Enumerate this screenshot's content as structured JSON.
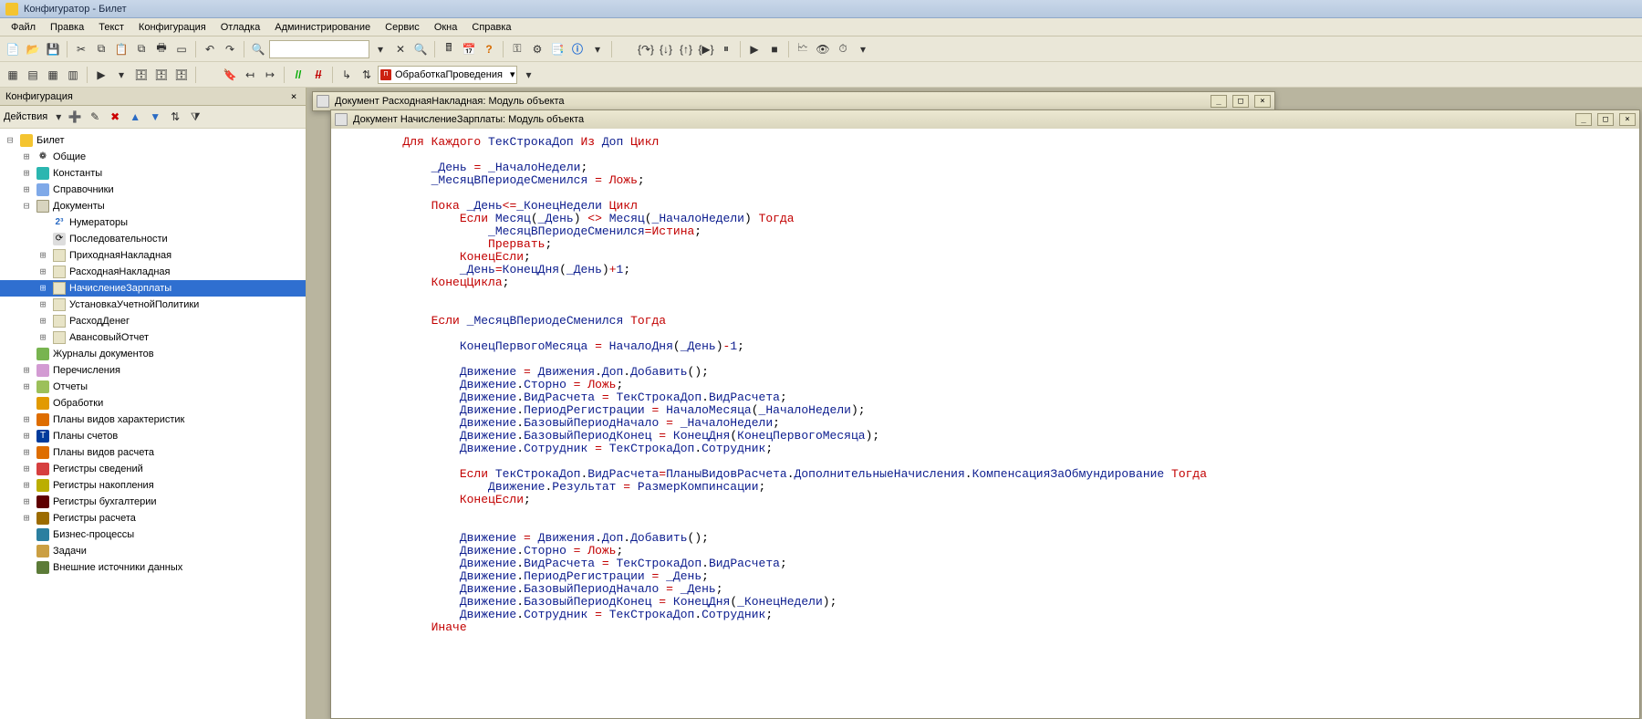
{
  "title": "Конфигуратор - Билет",
  "menu": [
    "Файл",
    "Правка",
    "Текст",
    "Конфигурация",
    "Отладка",
    "Администрирование",
    "Сервис",
    "Окна",
    "Справка"
  ],
  "proc_combo": "ОбработкаПроведения",
  "left_panel": {
    "title": "Конфигурация",
    "actions_label": "Действия"
  },
  "tree": {
    "root": "Билет",
    "common": "Общие",
    "constants": "Константы",
    "catalogs": "Справочники",
    "documents": "Документы",
    "numerators": "Нумераторы",
    "sequences": "Последовательности",
    "docs": [
      "ПриходнаяНакладная",
      "РасходнаяНакладная",
      "НачислениеЗарплаты",
      "УстановкаУчетнойПолитики",
      "РасходДенег",
      "АвансовыйОтчет"
    ],
    "journals": "Журналы документов",
    "enums": "Перечисления",
    "reports": "Отчеты",
    "processings": "Обработки",
    "charplans": "Планы видов характеристик",
    "accplans": "Планы счетов",
    "calcplans": "Планы видов расчета",
    "reginfo": "Регистры сведений",
    "regacc": "Регистры накопления",
    "regbuh": "Регистры бухгалтерии",
    "regcalc": "Регистры расчета",
    "bp": "Бизнес-процессы",
    "tasks": "Задачи",
    "external": "Внешние источники данных"
  },
  "tabs": {
    "back": "Документ РасходнаяНакладная: Модуль объекта",
    "front": "Документ НачислениеЗарплаты: Модуль объекта"
  },
  "code_lines": [
    {
      "indent": 2,
      "tokens": [
        {
          "t": "Для Каждого",
          "c": "kw"
        },
        {
          "t": " ТекСтрокаДоп ",
          "c": "id"
        },
        {
          "t": "Из",
          "c": "kw"
        },
        {
          "t": " Доп ",
          "c": "id"
        },
        {
          "t": "Цикл",
          "c": "kw"
        }
      ]
    },
    {
      "indent": 0,
      "text": ""
    },
    {
      "indent": 3,
      "tokens": [
        {
          "t": "_День ",
          "c": "id"
        },
        {
          "t": "= ",
          "c": "op"
        },
        {
          "t": "_НачалоНедели",
          "c": "id"
        },
        {
          "t": ";",
          "c": ""
        }
      ]
    },
    {
      "indent": 3,
      "tokens": [
        {
          "t": "_МесяцВПериодеСменился ",
          "c": "id"
        },
        {
          "t": "= ",
          "c": "op"
        },
        {
          "t": "Ложь",
          "c": "kw"
        },
        {
          "t": ";",
          "c": ""
        }
      ]
    },
    {
      "indent": 0,
      "text": ""
    },
    {
      "indent": 3,
      "tokens": [
        {
          "t": "Пока ",
          "c": "kw"
        },
        {
          "t": "_День",
          "c": "id"
        },
        {
          "t": "<=",
          "c": "op"
        },
        {
          "t": "_КонецНедели ",
          "c": "id"
        },
        {
          "t": "Цикл",
          "c": "kw"
        }
      ]
    },
    {
      "indent": 4,
      "tokens": [
        {
          "t": "Если ",
          "c": "kw"
        },
        {
          "t": "Месяц",
          "c": "id"
        },
        {
          "t": "(",
          "c": ""
        },
        {
          "t": "_День",
          "c": "id"
        },
        {
          "t": ") ",
          "c": ""
        },
        {
          "t": "<> ",
          "c": "op"
        },
        {
          "t": "Месяц",
          "c": "id"
        },
        {
          "t": "(",
          "c": ""
        },
        {
          "t": "_НачалоНедели",
          "c": "id"
        },
        {
          "t": ") ",
          "c": ""
        },
        {
          "t": "Тогда",
          "c": "kw"
        }
      ]
    },
    {
      "indent": 5,
      "tokens": [
        {
          "t": "_МесяцВПериодеСменился",
          "c": "id"
        },
        {
          "t": "=",
          "c": "op"
        },
        {
          "t": "Истина",
          "c": "kw"
        },
        {
          "t": ";",
          "c": ""
        }
      ]
    },
    {
      "indent": 5,
      "tokens": [
        {
          "t": "Прервать",
          "c": "kw"
        },
        {
          "t": ";",
          "c": ""
        }
      ]
    },
    {
      "indent": 4,
      "tokens": [
        {
          "t": "КонецЕсли",
          "c": "kw"
        },
        {
          "t": ";",
          "c": ""
        }
      ]
    },
    {
      "indent": 4,
      "tokens": [
        {
          "t": "_День",
          "c": "id"
        },
        {
          "t": "=",
          "c": "op"
        },
        {
          "t": "КонецДня",
          "c": "id"
        },
        {
          "t": "(",
          "c": ""
        },
        {
          "t": "_День",
          "c": "id"
        },
        {
          "t": ")",
          "c": ""
        },
        {
          "t": "+",
          "c": "op"
        },
        {
          "t": "1",
          "c": "id"
        },
        {
          "t": ";",
          "c": ""
        }
      ]
    },
    {
      "indent": 3,
      "tokens": [
        {
          "t": "КонецЦикла",
          "c": "kw"
        },
        {
          "t": ";",
          "c": ""
        }
      ]
    },
    {
      "indent": 0,
      "text": ""
    },
    {
      "indent": 0,
      "text": ""
    },
    {
      "indent": 3,
      "tokens": [
        {
          "t": "Если ",
          "c": "kw"
        },
        {
          "t": "_МесяцВПериодеСменился ",
          "c": "id"
        },
        {
          "t": "Тогда",
          "c": "kw"
        }
      ]
    },
    {
      "indent": 0,
      "text": ""
    },
    {
      "indent": 4,
      "tokens": [
        {
          "t": "КонецПервогоМесяца ",
          "c": "id"
        },
        {
          "t": "= ",
          "c": "op"
        },
        {
          "t": "НачалоДня",
          "c": "id"
        },
        {
          "t": "(",
          "c": ""
        },
        {
          "t": "_День",
          "c": "id"
        },
        {
          "t": ")",
          "c": ""
        },
        {
          "t": "-",
          "c": "op"
        },
        {
          "t": "1",
          "c": "id"
        },
        {
          "t": ";",
          "c": ""
        }
      ]
    },
    {
      "indent": 0,
      "text": ""
    },
    {
      "indent": 4,
      "tokens": [
        {
          "t": "Движение ",
          "c": "id"
        },
        {
          "t": "= ",
          "c": "op"
        },
        {
          "t": "Движения",
          "c": "id"
        },
        {
          "t": ".",
          "c": ""
        },
        {
          "t": "Доп",
          "c": "id"
        },
        {
          "t": ".",
          "c": ""
        },
        {
          "t": "Добавить",
          "c": "id"
        },
        {
          "t": "();",
          "c": ""
        }
      ]
    },
    {
      "indent": 4,
      "tokens": [
        {
          "t": "Движение",
          "c": "id"
        },
        {
          "t": ".",
          "c": ""
        },
        {
          "t": "Сторно ",
          "c": "id"
        },
        {
          "t": "= ",
          "c": "op"
        },
        {
          "t": "Ложь",
          "c": "kw"
        },
        {
          "t": ";",
          "c": ""
        }
      ]
    },
    {
      "indent": 4,
      "tokens": [
        {
          "t": "Движение",
          "c": "id"
        },
        {
          "t": ".",
          "c": ""
        },
        {
          "t": "ВидРасчета ",
          "c": "id"
        },
        {
          "t": "= ",
          "c": "op"
        },
        {
          "t": "ТекСтрокаДоп",
          "c": "id"
        },
        {
          "t": ".",
          "c": ""
        },
        {
          "t": "ВидРасчета",
          "c": "id"
        },
        {
          "t": ";",
          "c": ""
        }
      ]
    },
    {
      "indent": 4,
      "tokens": [
        {
          "t": "Движение",
          "c": "id"
        },
        {
          "t": ".",
          "c": ""
        },
        {
          "t": "ПериодРегистрации ",
          "c": "id"
        },
        {
          "t": "= ",
          "c": "op"
        },
        {
          "t": "НачалоМесяца",
          "c": "id"
        },
        {
          "t": "(",
          "c": ""
        },
        {
          "t": "_НачалоНедели",
          "c": "id"
        },
        {
          "t": ");",
          "c": ""
        }
      ]
    },
    {
      "indent": 4,
      "tokens": [
        {
          "t": "Движение",
          "c": "id"
        },
        {
          "t": ".",
          "c": ""
        },
        {
          "t": "БазовыйПериодНачало ",
          "c": "id"
        },
        {
          "t": "= ",
          "c": "op"
        },
        {
          "t": "_НачалоНедели",
          "c": "id"
        },
        {
          "t": ";",
          "c": ""
        }
      ]
    },
    {
      "indent": 4,
      "tokens": [
        {
          "t": "Движение",
          "c": "id"
        },
        {
          "t": ".",
          "c": ""
        },
        {
          "t": "БазовыйПериодКонец ",
          "c": "id"
        },
        {
          "t": "= ",
          "c": "op"
        },
        {
          "t": "КонецДня",
          "c": "id"
        },
        {
          "t": "(",
          "c": ""
        },
        {
          "t": "КонецПервогоМесяца",
          "c": "id"
        },
        {
          "t": ");",
          "c": ""
        }
      ]
    },
    {
      "indent": 4,
      "tokens": [
        {
          "t": "Движение",
          "c": "id"
        },
        {
          "t": ".",
          "c": ""
        },
        {
          "t": "Сотрудник ",
          "c": "id"
        },
        {
          "t": "= ",
          "c": "op"
        },
        {
          "t": "ТекСтрокаДоп",
          "c": "id"
        },
        {
          "t": ".",
          "c": ""
        },
        {
          "t": "Сотрудник",
          "c": "id"
        },
        {
          "t": ";",
          "c": ""
        }
      ]
    },
    {
      "indent": 0,
      "text": ""
    },
    {
      "indent": 4,
      "tokens": [
        {
          "t": "Если ",
          "c": "kw"
        },
        {
          "t": "ТекСтрокаДоп",
          "c": "id"
        },
        {
          "t": ".",
          "c": ""
        },
        {
          "t": "ВидРасчета",
          "c": "id"
        },
        {
          "t": "=",
          "c": "op"
        },
        {
          "t": "ПланыВидовРасчета",
          "c": "id"
        },
        {
          "t": ".",
          "c": ""
        },
        {
          "t": "ДополнительныеНачисления",
          "c": "id"
        },
        {
          "t": ".",
          "c": ""
        },
        {
          "t": "КомпенсацияЗаОбмундирование ",
          "c": "id"
        },
        {
          "t": "Тогда",
          "c": "kw"
        }
      ]
    },
    {
      "indent": 5,
      "tokens": [
        {
          "t": "Движение",
          "c": "id"
        },
        {
          "t": ".",
          "c": ""
        },
        {
          "t": "Результат ",
          "c": "id"
        },
        {
          "t": "= ",
          "c": "op"
        },
        {
          "t": "РазмерКомпинсации",
          "c": "id"
        },
        {
          "t": ";",
          "c": ""
        }
      ]
    },
    {
      "indent": 4,
      "tokens": [
        {
          "t": "КонецЕсли",
          "c": "kw"
        },
        {
          "t": ";",
          "c": ""
        }
      ]
    },
    {
      "indent": 0,
      "text": ""
    },
    {
      "indent": 0,
      "text": ""
    },
    {
      "indent": 4,
      "tokens": [
        {
          "t": "Движение ",
          "c": "id"
        },
        {
          "t": "= ",
          "c": "op"
        },
        {
          "t": "Движения",
          "c": "id"
        },
        {
          "t": ".",
          "c": ""
        },
        {
          "t": "Доп",
          "c": "id"
        },
        {
          "t": ".",
          "c": ""
        },
        {
          "t": "Добавить",
          "c": "id"
        },
        {
          "t": "();",
          "c": ""
        }
      ]
    },
    {
      "indent": 4,
      "tokens": [
        {
          "t": "Движение",
          "c": "id"
        },
        {
          "t": ".",
          "c": ""
        },
        {
          "t": "Сторно ",
          "c": "id"
        },
        {
          "t": "= ",
          "c": "op"
        },
        {
          "t": "Ложь",
          "c": "kw"
        },
        {
          "t": ";",
          "c": ""
        }
      ]
    },
    {
      "indent": 4,
      "tokens": [
        {
          "t": "Движение",
          "c": "id"
        },
        {
          "t": ".",
          "c": ""
        },
        {
          "t": "ВидРасчета ",
          "c": "id"
        },
        {
          "t": "= ",
          "c": "op"
        },
        {
          "t": "ТекСтрокаДоп",
          "c": "id"
        },
        {
          "t": ".",
          "c": ""
        },
        {
          "t": "ВидРасчета",
          "c": "id"
        },
        {
          "t": ";",
          "c": ""
        }
      ]
    },
    {
      "indent": 4,
      "tokens": [
        {
          "t": "Движение",
          "c": "id"
        },
        {
          "t": ".",
          "c": ""
        },
        {
          "t": "ПериодРегистрации ",
          "c": "id"
        },
        {
          "t": "= ",
          "c": "op"
        },
        {
          "t": "_День",
          "c": "id"
        },
        {
          "t": ";",
          "c": ""
        }
      ]
    },
    {
      "indent": 4,
      "tokens": [
        {
          "t": "Движение",
          "c": "id"
        },
        {
          "t": ".",
          "c": ""
        },
        {
          "t": "БазовыйПериодНачало ",
          "c": "id"
        },
        {
          "t": "= ",
          "c": "op"
        },
        {
          "t": "_День",
          "c": "id"
        },
        {
          "t": ";",
          "c": ""
        }
      ]
    },
    {
      "indent": 4,
      "tokens": [
        {
          "t": "Движение",
          "c": "id"
        },
        {
          "t": ".",
          "c": ""
        },
        {
          "t": "БазовыйПериодКонец ",
          "c": "id"
        },
        {
          "t": "= ",
          "c": "op"
        },
        {
          "t": "КонецДня",
          "c": "id"
        },
        {
          "t": "(",
          "c": ""
        },
        {
          "t": "_КонецНедели",
          "c": "id"
        },
        {
          "t": ");",
          "c": ""
        }
      ]
    },
    {
      "indent": 4,
      "tokens": [
        {
          "t": "Движение",
          "c": "id"
        },
        {
          "t": ".",
          "c": ""
        },
        {
          "t": "Сотрудник ",
          "c": "id"
        },
        {
          "t": "= ",
          "c": "op"
        },
        {
          "t": "ТекСтрокаДоп",
          "c": "id"
        },
        {
          "t": ".",
          "c": ""
        },
        {
          "t": "Сотрудник",
          "c": "id"
        },
        {
          "t": ";",
          "c": ""
        }
      ]
    },
    {
      "indent": 3,
      "tokens": [
        {
          "t": "Иначе",
          "c": "kw"
        }
      ]
    }
  ]
}
